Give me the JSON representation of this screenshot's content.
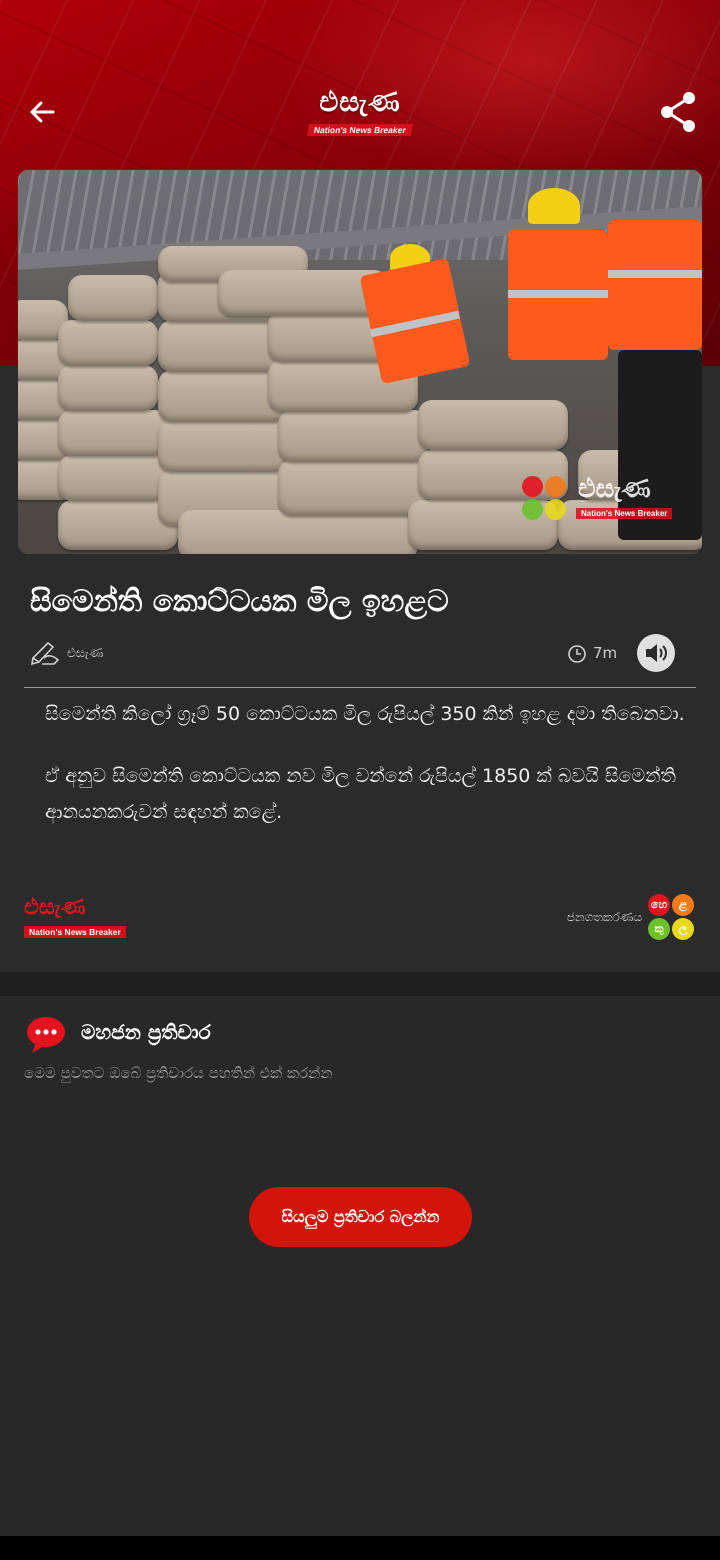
{
  "header": {
    "logo_word": "එසැණ",
    "logo_tagline": "Nation's News Breaker",
    "back_icon": "arrow-left-icon",
    "share_icon": "share-icon"
  },
  "hero": {
    "watermark_word": "එසැණ",
    "watermark_tagline": "Nation's News Breaker"
  },
  "article": {
    "title": "සිමෙන්ති කොට්ටයක මිල ඉහළට",
    "author": "එසැණ",
    "time": "7m",
    "paragraphs": [
      "සිමෙන්ති කිලෝ ග්‍රෑම් 50 කොට්ටයක මිල රුපියල් 350 කින් ඉහළ දමා තිබෙනවා.",
      "ඒ අනුව සිමෙන්ති කොට්ටයක නව මිල වන්නේ රුපියල් 1850 ක් බවයි සිමෙන්ති ආනයනකරුවන් සඳහන් කළේ."
    ]
  },
  "footer": {
    "brand_word": "එසැණ",
    "brand_tagline": "Nation's News Breaker",
    "popularity_label": "ජනගතකරණය",
    "popularity_dots": [
      "හෙ",
      "ළ",
      "කු",
      "ල"
    ]
  },
  "comments": {
    "title": "මහජන ප්‍රතිචාර",
    "subtitle": "මෙම පුවතට ඔබේ ප්‍රතිචාරය පහතින් එක් කරන්න",
    "view_all_label": "සියලුම ප්‍රතිචාර බලන්න"
  },
  "colors": {
    "brand_red": "#d3140a",
    "background": "#2b2b2b"
  }
}
